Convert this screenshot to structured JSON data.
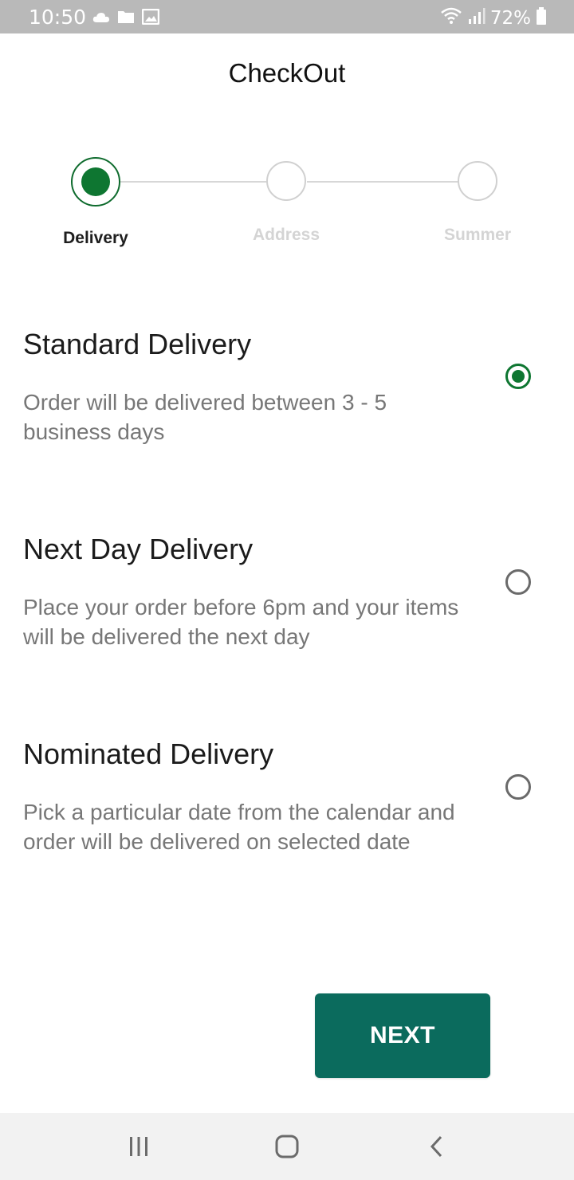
{
  "status_bar": {
    "time": "10:50",
    "battery": "72%",
    "icons": [
      "cloud-icon",
      "folder-icon",
      "image-icon",
      "wifi-icon",
      "signal-icon",
      "battery-icon"
    ]
  },
  "header": {
    "title": "CheckOut"
  },
  "stepper": {
    "steps": [
      {
        "label": "Delivery",
        "state": "active"
      },
      {
        "label": "Address",
        "state": "inactive"
      },
      {
        "label": "Summer",
        "state": "inactive"
      }
    ]
  },
  "delivery_options": [
    {
      "title": "Standard Delivery",
      "description": "Order will be delivered between 3 - 5 business days",
      "selected": true
    },
    {
      "title": "Next Day Delivery",
      "description": "Place your order before 6pm and your items will be delivered the next day",
      "selected": false
    },
    {
      "title": "Nominated Delivery",
      "description": "Pick a particular date from the calendar and order will be delivered on selected date",
      "selected": false
    }
  ],
  "actions": {
    "next_label": "NEXT"
  },
  "nav_bar": {
    "icons": [
      "recents-icon",
      "home-icon",
      "back-icon"
    ]
  },
  "colors": {
    "accent_green": "#0e7631",
    "button_teal": "#0b6b5d",
    "status_bar_bg": "#b9b9b9",
    "inactive_step": "#d4d4d4"
  }
}
